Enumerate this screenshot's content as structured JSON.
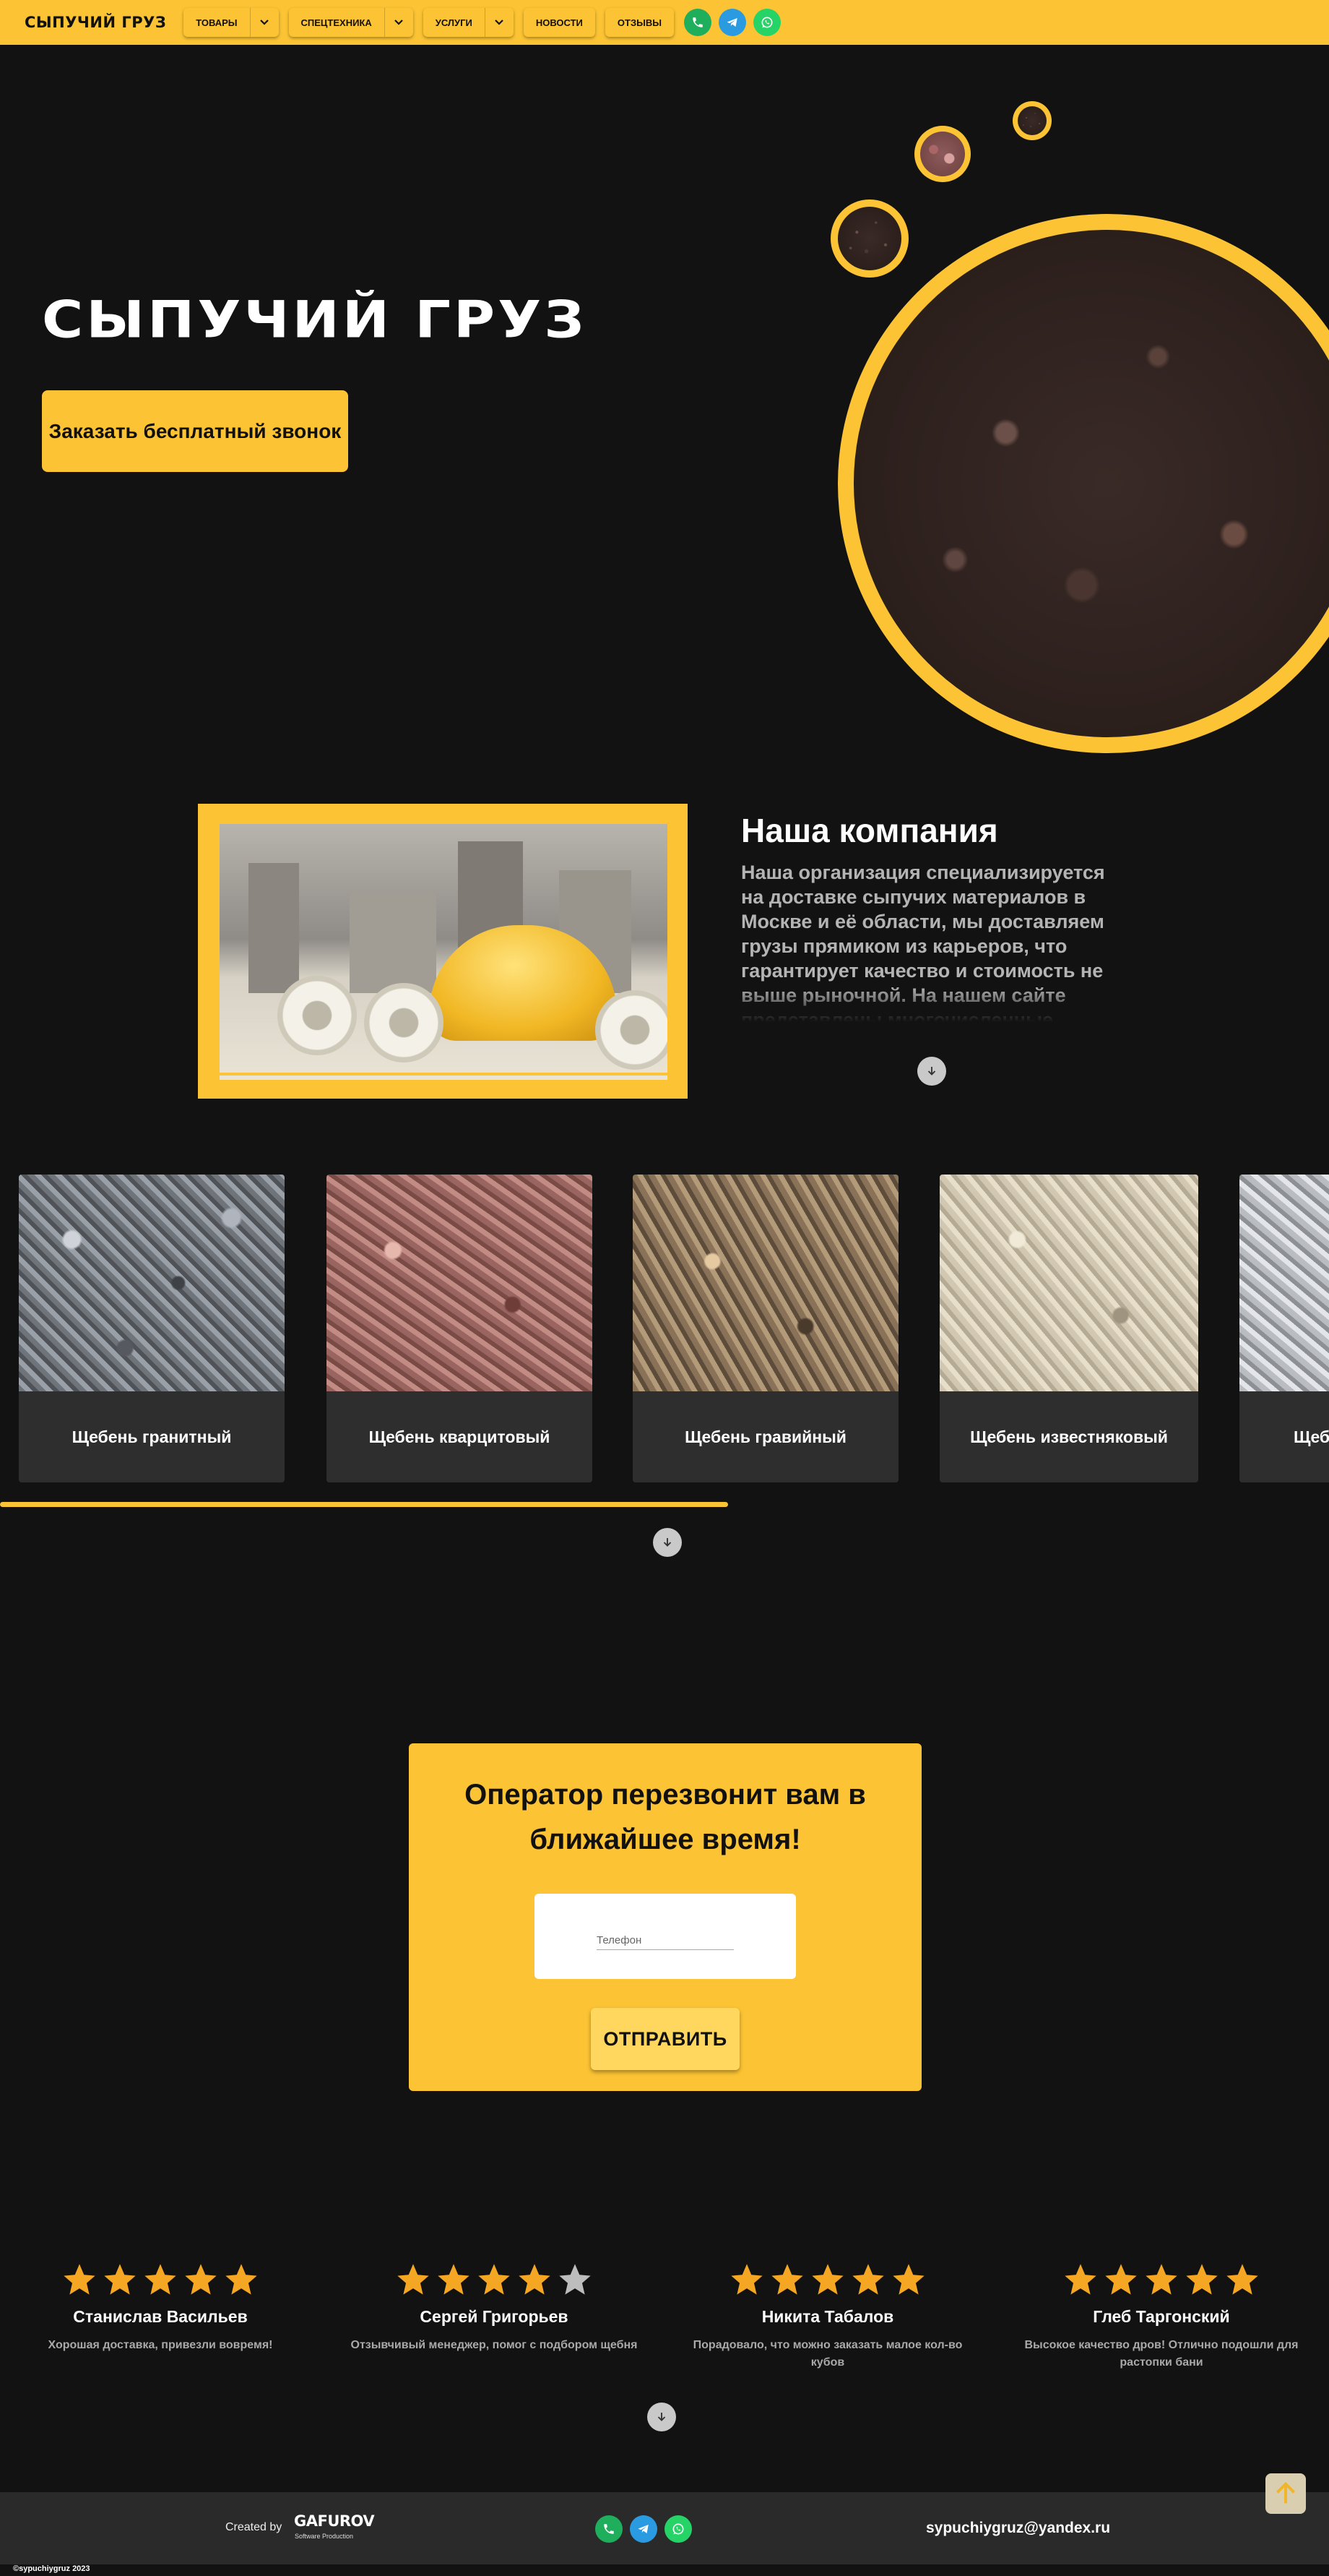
{
  "nav": {
    "brand": "СЫПУЧИЙ ГРУЗ",
    "items": [
      {
        "label": "ТОВАРЫ",
        "has_dropdown": true
      },
      {
        "label": "СПЕЦТЕХНИКА",
        "has_dropdown": true
      },
      {
        "label": "УСЛУГИ",
        "has_dropdown": true
      },
      {
        "label": "НОВОСТИ",
        "has_dropdown": false
      },
      {
        "label": "ОТЗЫВЫ",
        "has_dropdown": false
      }
    ],
    "contacts": [
      "phone-icon",
      "telegram-icon",
      "whatsapp-icon"
    ]
  },
  "hero": {
    "title": "СЫПУЧИЙ ГРУЗ",
    "cta": "Заказать бесплатный звонок"
  },
  "company": {
    "title": "Наша компания",
    "text": "Наша организация специализируется на доставке сыпучих материалов в Москве и её области, мы доставляем грузы прямиком из карьеров, что гарантирует качество и стоимость не выше рыночной. На нашем сайте представлены многочисленные"
  },
  "products": [
    {
      "name": "Щебень гранитный"
    },
    {
      "name": "Щебень кварцитовый"
    },
    {
      "name": "Щебень гравийный"
    },
    {
      "name": "Щебень известняковый"
    },
    {
      "name": "Щеб"
    }
  ],
  "callback": {
    "title_line1": "Оператор перезвонит вам в",
    "title_line2": "ближайшее время!",
    "phone_placeholder": "Телефон",
    "submit": "ОТПРАВИТЬ"
  },
  "reviews": [
    {
      "name": "Станислав Васильев",
      "rating": 5,
      "text": "Хорошая доставка, привезли вовремя!"
    },
    {
      "name": "Сергей Григорьев",
      "rating": 4,
      "text": "Отзывчивый менеджер, помог с подбором щебня"
    },
    {
      "name": "Никита Табалов",
      "rating": 5,
      "text": "Порадовало, что можно заказать малое кол-во кубов"
    },
    {
      "name": "Глеб Таргонский",
      "rating": 5,
      "text": "Высокое качество дров! Отлично подошли для растопки бани"
    }
  ],
  "footer": {
    "created_by": "Created by",
    "logo": "GAFUROV",
    "logo_sub": "Software Production",
    "email": "sypuchiygruz@yandex.ru",
    "copyright": "©sypuchiygruz 2023"
  },
  "colors": {
    "accent": "#fcc434",
    "background": "#121212",
    "card": "#2e2e2e",
    "star_active": "#f5a623",
    "star_inactive": "#bdbdbd"
  }
}
